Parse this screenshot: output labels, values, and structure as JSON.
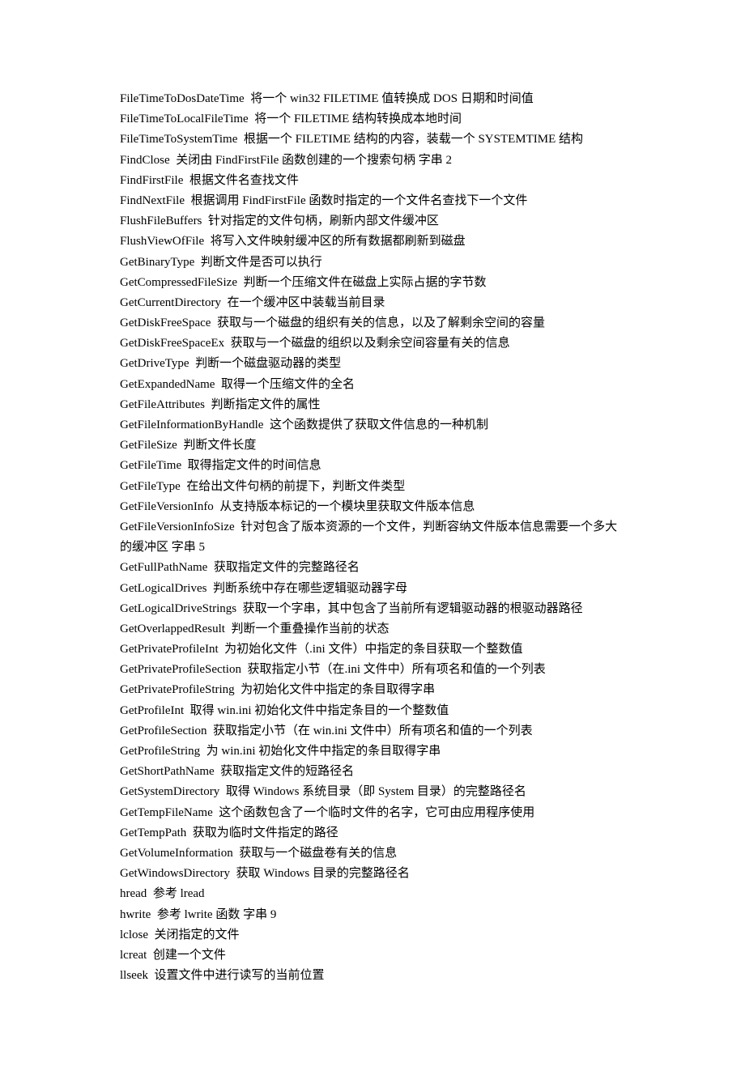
{
  "entries": [
    {
      "fn": "FileTimeToDosDateTime ",
      "desc": " 将一个  win32 FILETIME  值转换成 DOS 日期和时间值"
    },
    {
      "fn": "FileTimeToLocalFileTime ",
      "desc": " 将一个 FILETIME 结构转换成本地时间"
    },
    {
      "fn": "FileTimeToSystemTime ",
      "desc": " 根据一个 FILETIME 结构的内容，装载一个 SYSTEMTIME 结构"
    },
    {
      "fn": "FindClose ",
      "desc": " 关闭由 FindFirstFile 函数创建的一个搜索句柄  字串 2"
    },
    {
      "fn": "FindFirstFile ",
      "desc": " 根据文件名查找文件"
    },
    {
      "fn": "FindNextFile ",
      "desc": " 根据调用 FindFirstFile 函数时指定的一个文件名查找下一个文件"
    },
    {
      "fn": "FlushFileBuffers ",
      "desc": " 针对指定的文件句柄，刷新内部文件缓冲区"
    },
    {
      "fn": "FlushViewOfFile ",
      "desc": " 将写入文件映射缓冲区的所有数据都刷新到磁盘"
    },
    {
      "fn": "GetBinaryType ",
      "desc": " 判断文件是否可以执行"
    },
    {
      "fn": "GetCompressedFileSize ",
      "desc": " 判断一个压缩文件在磁盘上实际占据的字节数"
    },
    {
      "fn": "GetCurrentDirectory ",
      "desc": " 在一个缓冲区中装载当前目录"
    },
    {
      "fn": "GetDiskFreeSpace ",
      "desc": " 获取与一个磁盘的组织有关的信息，以及了解剩余空间的容量"
    },
    {
      "fn": "GetDiskFreeSpaceEx ",
      "desc": " 获取与一个磁盘的组织以及剩余空间容量有关的信息"
    },
    {
      "fn": "GetDriveType ",
      "desc": " 判断一个磁盘驱动器的类型"
    },
    {
      "fn": "GetExpandedName ",
      "desc": " 取得一个压缩文件的全名"
    },
    {
      "fn": "GetFileAttributes ",
      "desc": " 判断指定文件的属性"
    },
    {
      "fn": "GetFileInformationByHandle ",
      "desc": " 这个函数提供了获取文件信息的一种机制"
    },
    {
      "fn": "GetFileSize ",
      "desc": " 判断文件长度"
    },
    {
      "fn": "GetFileTime ",
      "desc": " 取得指定文件的时间信息"
    },
    {
      "fn": "GetFileType ",
      "desc": " 在给出文件句柄的前提下，判断文件类型"
    },
    {
      "fn": "GetFileVersionInfo ",
      "desc": " 从支持版本标记的一个模块里获取文件版本信息"
    },
    {
      "fn": "GetFileVersionInfoSize ",
      "desc": " 针对包含了版本资源的一个文件，判断容纳文件版本信息需要一个多大的缓冲区  字串 5"
    },
    {
      "fn": "GetFullPathName ",
      "desc": " 获取指定文件的完整路径名"
    },
    {
      "fn": "GetLogicalDrives ",
      "desc": " 判断系统中存在哪些逻辑驱动器字母"
    },
    {
      "fn": "GetLogicalDriveStrings ",
      "desc": " 获取一个字串，其中包含了当前所有逻辑驱动器的根驱动器路径"
    },
    {
      "fn": "GetOverlappedResult ",
      "desc": " 判断一个重叠操作当前的状态"
    },
    {
      "fn": "GetPrivateProfileInt ",
      "desc": " 为初始化文件（.ini 文件）中指定的条目获取一个整数值"
    },
    {
      "fn": "GetPrivateProfileSection ",
      "desc": " 获取指定小节（在.ini 文件中）所有项名和值的一个列表"
    },
    {
      "fn": "GetPrivateProfileString ",
      "desc": " 为初始化文件中指定的条目取得字串"
    },
    {
      "fn": "GetProfileInt ",
      "desc": " 取得 win.ini 初始化文件中指定条目的一个整数值"
    },
    {
      "fn": "GetProfileSection ",
      "desc": " 获取指定小节（在 win.ini 文件中）所有项名和值的一个列表"
    },
    {
      "fn": "GetProfileString ",
      "desc": " 为 win.ini 初始化文件中指定的条目取得字串"
    },
    {
      "fn": "GetShortPathName ",
      "desc": " 获取指定文件的短路径名"
    },
    {
      "fn": "GetSystemDirectory ",
      "desc": " 取得 Windows 系统目录（即 System 目录）的完整路径名"
    },
    {
      "fn": "GetTempFileName ",
      "desc": " 这个函数包含了一个临时文件的名字，它可由应用程序使用"
    },
    {
      "fn": "GetTempPath ",
      "desc": " 获取为临时文件指定的路径"
    },
    {
      "fn": "GetVolumeInformation ",
      "desc": " 获取与一个磁盘卷有关的信息"
    },
    {
      "fn": "GetWindowsDirectory ",
      "desc": " 获取 Windows 目录的完整路径名"
    },
    {
      "fn": "hread ",
      "desc": " 参考 lread"
    },
    {
      "fn": "hwrite ",
      "desc": " 参考 lwrite 函数  字串 9"
    },
    {
      "fn": "lclose ",
      "desc": " 关闭指定的文件"
    },
    {
      "fn": "lcreat ",
      "desc": " 创建一个文件"
    },
    {
      "fn": "llseek ",
      "desc": " 设置文件中进行读写的当前位置"
    }
  ]
}
